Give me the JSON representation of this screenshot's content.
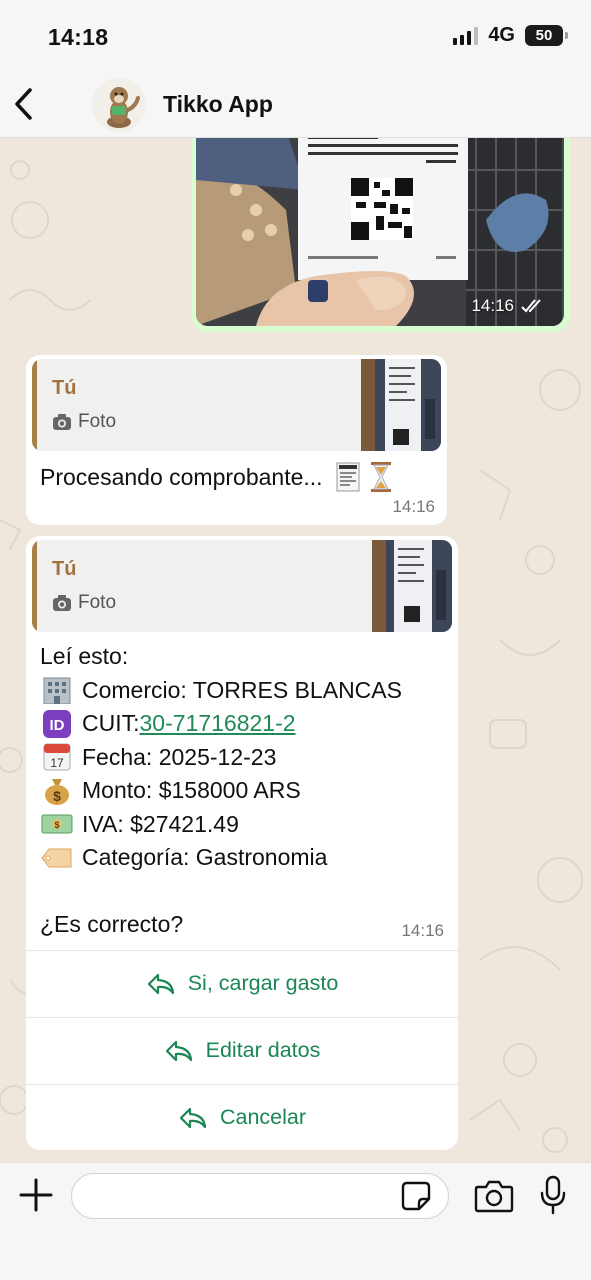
{
  "status_bar": {
    "time": "14:18",
    "network": "4G",
    "battery": "50"
  },
  "header": {
    "title": "Tikko App"
  },
  "image_message": {
    "time": "14:16"
  },
  "processing_message": {
    "quote_author": "Tú",
    "quote_kind": "Foto",
    "text": "Procesando comprobante...",
    "time": "14:16"
  },
  "result_message": {
    "quote_author": "Tú",
    "quote_kind": "Foto",
    "intro": "Leí esto:",
    "lines": [
      {
        "icon": "office-building-icon",
        "label": "Comercio: TORRES BLANCAS"
      },
      {
        "icon": "id-icon",
        "label": "CUIT: ",
        "link": "30-71716821-2"
      },
      {
        "icon": "calendar-icon",
        "label": "Fecha: 2025-12-23"
      },
      {
        "icon": "money-bag-icon",
        "label": "Monto: $158000 ARS"
      },
      {
        "icon": "banknote-icon",
        "label": "IVA: $27421.49"
      },
      {
        "icon": "label-tag-icon",
        "label": "Categoría: Gastronomia"
      }
    ],
    "question": "¿Es correcto?",
    "time": "14:16",
    "buttons": [
      "Si, cargar gasto",
      "Editar datos",
      "Cancelar"
    ]
  },
  "composer": {
    "placeholder": ""
  },
  "colors": {
    "accent_green": "#1b8755",
    "quote_brown": "#a1733e",
    "outgoing": "#d9fdd3"
  }
}
